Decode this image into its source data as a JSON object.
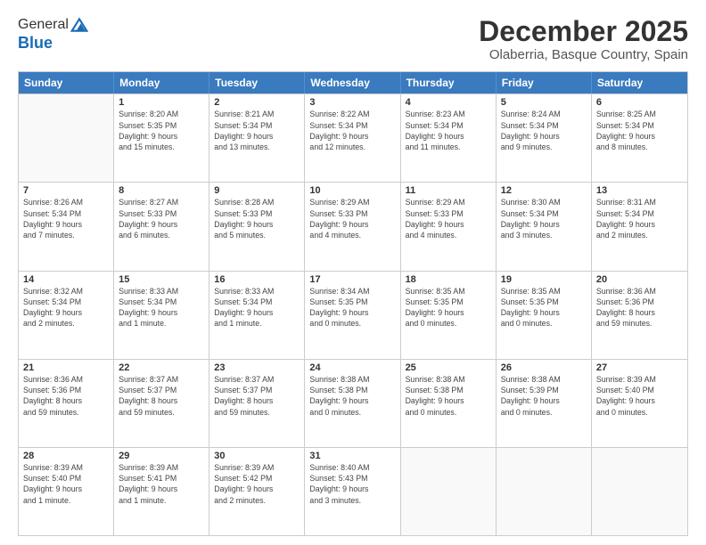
{
  "logo": {
    "general": "General",
    "blue": "Blue"
  },
  "title": "December 2025",
  "location": "Olaberria, Basque Country, Spain",
  "headers": [
    "Sunday",
    "Monday",
    "Tuesday",
    "Wednesday",
    "Thursday",
    "Friday",
    "Saturday"
  ],
  "weeks": [
    [
      {
        "day": "",
        "info": ""
      },
      {
        "day": "1",
        "info": "Sunrise: 8:20 AM\nSunset: 5:35 PM\nDaylight: 9 hours\nand 15 minutes."
      },
      {
        "day": "2",
        "info": "Sunrise: 8:21 AM\nSunset: 5:34 PM\nDaylight: 9 hours\nand 13 minutes."
      },
      {
        "day": "3",
        "info": "Sunrise: 8:22 AM\nSunset: 5:34 PM\nDaylight: 9 hours\nand 12 minutes."
      },
      {
        "day": "4",
        "info": "Sunrise: 8:23 AM\nSunset: 5:34 PM\nDaylight: 9 hours\nand 11 minutes."
      },
      {
        "day": "5",
        "info": "Sunrise: 8:24 AM\nSunset: 5:34 PM\nDaylight: 9 hours\nand 9 minutes."
      },
      {
        "day": "6",
        "info": "Sunrise: 8:25 AM\nSunset: 5:34 PM\nDaylight: 9 hours\nand 8 minutes."
      }
    ],
    [
      {
        "day": "7",
        "info": "Sunrise: 8:26 AM\nSunset: 5:34 PM\nDaylight: 9 hours\nand 7 minutes."
      },
      {
        "day": "8",
        "info": "Sunrise: 8:27 AM\nSunset: 5:33 PM\nDaylight: 9 hours\nand 6 minutes."
      },
      {
        "day": "9",
        "info": "Sunrise: 8:28 AM\nSunset: 5:33 PM\nDaylight: 9 hours\nand 5 minutes."
      },
      {
        "day": "10",
        "info": "Sunrise: 8:29 AM\nSunset: 5:33 PM\nDaylight: 9 hours\nand 4 minutes."
      },
      {
        "day": "11",
        "info": "Sunrise: 8:29 AM\nSunset: 5:33 PM\nDaylight: 9 hours\nand 4 minutes."
      },
      {
        "day": "12",
        "info": "Sunrise: 8:30 AM\nSunset: 5:34 PM\nDaylight: 9 hours\nand 3 minutes."
      },
      {
        "day": "13",
        "info": "Sunrise: 8:31 AM\nSunset: 5:34 PM\nDaylight: 9 hours\nand 2 minutes."
      }
    ],
    [
      {
        "day": "14",
        "info": "Sunrise: 8:32 AM\nSunset: 5:34 PM\nDaylight: 9 hours\nand 2 minutes."
      },
      {
        "day": "15",
        "info": "Sunrise: 8:33 AM\nSunset: 5:34 PM\nDaylight: 9 hours\nand 1 minute."
      },
      {
        "day": "16",
        "info": "Sunrise: 8:33 AM\nSunset: 5:34 PM\nDaylight: 9 hours\nand 1 minute."
      },
      {
        "day": "17",
        "info": "Sunrise: 8:34 AM\nSunset: 5:35 PM\nDaylight: 9 hours\nand 0 minutes."
      },
      {
        "day": "18",
        "info": "Sunrise: 8:35 AM\nSunset: 5:35 PM\nDaylight: 9 hours\nand 0 minutes."
      },
      {
        "day": "19",
        "info": "Sunrise: 8:35 AM\nSunset: 5:35 PM\nDaylight: 9 hours\nand 0 minutes."
      },
      {
        "day": "20",
        "info": "Sunrise: 8:36 AM\nSunset: 5:36 PM\nDaylight: 8 hours\nand 59 minutes."
      }
    ],
    [
      {
        "day": "21",
        "info": "Sunrise: 8:36 AM\nSunset: 5:36 PM\nDaylight: 8 hours\nand 59 minutes."
      },
      {
        "day": "22",
        "info": "Sunrise: 8:37 AM\nSunset: 5:37 PM\nDaylight: 8 hours\nand 59 minutes."
      },
      {
        "day": "23",
        "info": "Sunrise: 8:37 AM\nSunset: 5:37 PM\nDaylight: 8 hours\nand 59 minutes."
      },
      {
        "day": "24",
        "info": "Sunrise: 8:38 AM\nSunset: 5:38 PM\nDaylight: 9 hours\nand 0 minutes."
      },
      {
        "day": "25",
        "info": "Sunrise: 8:38 AM\nSunset: 5:38 PM\nDaylight: 9 hours\nand 0 minutes."
      },
      {
        "day": "26",
        "info": "Sunrise: 8:38 AM\nSunset: 5:39 PM\nDaylight: 9 hours\nand 0 minutes."
      },
      {
        "day": "27",
        "info": "Sunrise: 8:39 AM\nSunset: 5:40 PM\nDaylight: 9 hours\nand 0 minutes."
      }
    ],
    [
      {
        "day": "28",
        "info": "Sunrise: 8:39 AM\nSunset: 5:40 PM\nDaylight: 9 hours\nand 1 minute."
      },
      {
        "day": "29",
        "info": "Sunrise: 8:39 AM\nSunset: 5:41 PM\nDaylight: 9 hours\nand 1 minute."
      },
      {
        "day": "30",
        "info": "Sunrise: 8:39 AM\nSunset: 5:42 PM\nDaylight: 9 hours\nand 2 minutes."
      },
      {
        "day": "31",
        "info": "Sunrise: 8:40 AM\nSunset: 5:43 PM\nDaylight: 9 hours\nand 3 minutes."
      },
      {
        "day": "",
        "info": ""
      },
      {
        "day": "",
        "info": ""
      },
      {
        "day": "",
        "info": ""
      }
    ]
  ]
}
